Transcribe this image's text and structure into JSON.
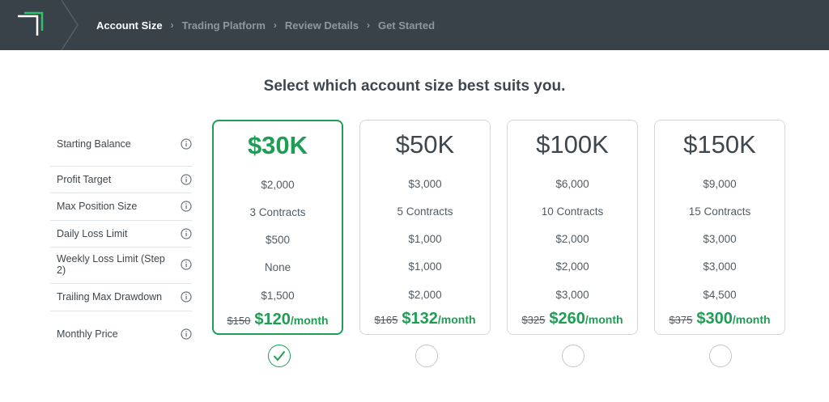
{
  "header": {
    "steps": [
      {
        "label": "Account Size",
        "active": true
      },
      {
        "label": "Trading Platform",
        "active": false
      },
      {
        "label": "Review Details",
        "active": false
      },
      {
        "label": "Get Started",
        "active": false
      }
    ]
  },
  "title": "Select which account size best suits you.",
  "row_labels": [
    "Starting Balance",
    "Profit Target",
    "Max Position Size",
    "Daily Loss Limit",
    "Weekly Loss Limit (Step 2)",
    "Trailing Max Drawdown",
    "Monthly Price"
  ],
  "plans": [
    {
      "size": "$30K",
      "profit_target": "$2,000",
      "max_position": "3 Contracts",
      "daily_loss": "$500",
      "weekly_loss": "None",
      "trailing_drawdown": "$1,500",
      "old_price": "$150",
      "price": "$120",
      "per": "/month",
      "selected": true
    },
    {
      "size": "$50K",
      "profit_target": "$3,000",
      "max_position": "5 Contracts",
      "daily_loss": "$1,000",
      "weekly_loss": "$1,000",
      "trailing_drawdown": "$2,000",
      "old_price": "$165",
      "price": "$132",
      "per": "/month",
      "selected": false
    },
    {
      "size": "$100K",
      "profit_target": "$6,000",
      "max_position": "10 Contracts",
      "daily_loss": "$2,000",
      "weekly_loss": "$2,000",
      "trailing_drawdown": "$3,000",
      "old_price": "$325",
      "price": "$260",
      "per": "/month",
      "selected": false
    },
    {
      "size": "$150K",
      "profit_target": "$9,000",
      "max_position": "15 Contracts",
      "daily_loss": "$3,000",
      "weekly_loss": "$3,000",
      "trailing_drawdown": "$4,500",
      "old_price": "$375",
      "price": "$300",
      "per": "/month",
      "selected": false
    }
  ],
  "icons": {
    "logo": "logo-bracket-icon",
    "separator": "chevron-separator-icon",
    "info": "info-icon",
    "check": "check-icon"
  },
  "colors": {
    "header_bg": "#3a4249",
    "accent_green": "#1f9d55",
    "text": "#3e474e",
    "muted": "#8e979e"
  }
}
